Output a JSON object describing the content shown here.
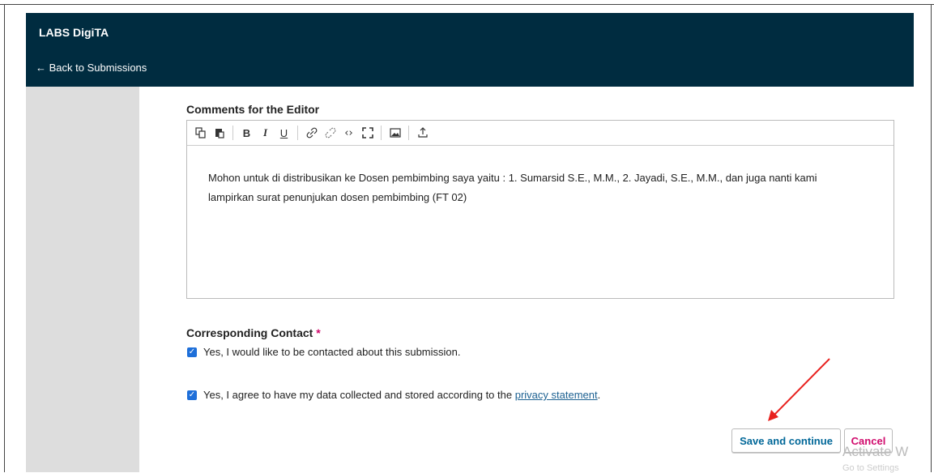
{
  "header": {
    "brand": "LABS DigiTA",
    "back_link": "← Back to Submissions"
  },
  "comments": {
    "label": "Comments for the Editor",
    "body": "Mohon untuk di distribusikan ke Dosen pembimbing saya yaitu : 1. Sumarsid S.E., M.M., 2. Jayadi, S.E., M.M., dan juga nanti kami lampirkan surat penunjukan dosen pembimbing (FT 02)",
    "toolbar": {
      "copy": "copy-icon",
      "paste": "paste-icon",
      "bold": "B",
      "italic": "I",
      "underline": "U",
      "link": "link-icon",
      "unlink": "unlink-icon",
      "code": "‹›",
      "fullscreen": "fullscreen-icon",
      "image": "image-icon",
      "upload": "upload-icon"
    }
  },
  "contact": {
    "label": "Corresponding Contact",
    "required_mark": "*",
    "option1": "Yes, I would like to be contacted about this submission.",
    "option2_prefix": "Yes, I agree to have my data collected and stored according to the",
    "option2_link": "privacy statement",
    "option2_suffix": ".",
    "option1_checked": true,
    "option2_checked": true
  },
  "actions": {
    "save": "Save and continue",
    "cancel": "Cancel"
  },
  "watermark": {
    "line1": "Activate W",
    "line2": "Go to Settings"
  },
  "colors": {
    "header_bg": "#002c40",
    "sidebar_bg": "#dddddd",
    "accent": "#006798",
    "danger": "#d00a6c",
    "checkbox": "#1e6fd9",
    "annotation_arrow": "#e8211e"
  }
}
